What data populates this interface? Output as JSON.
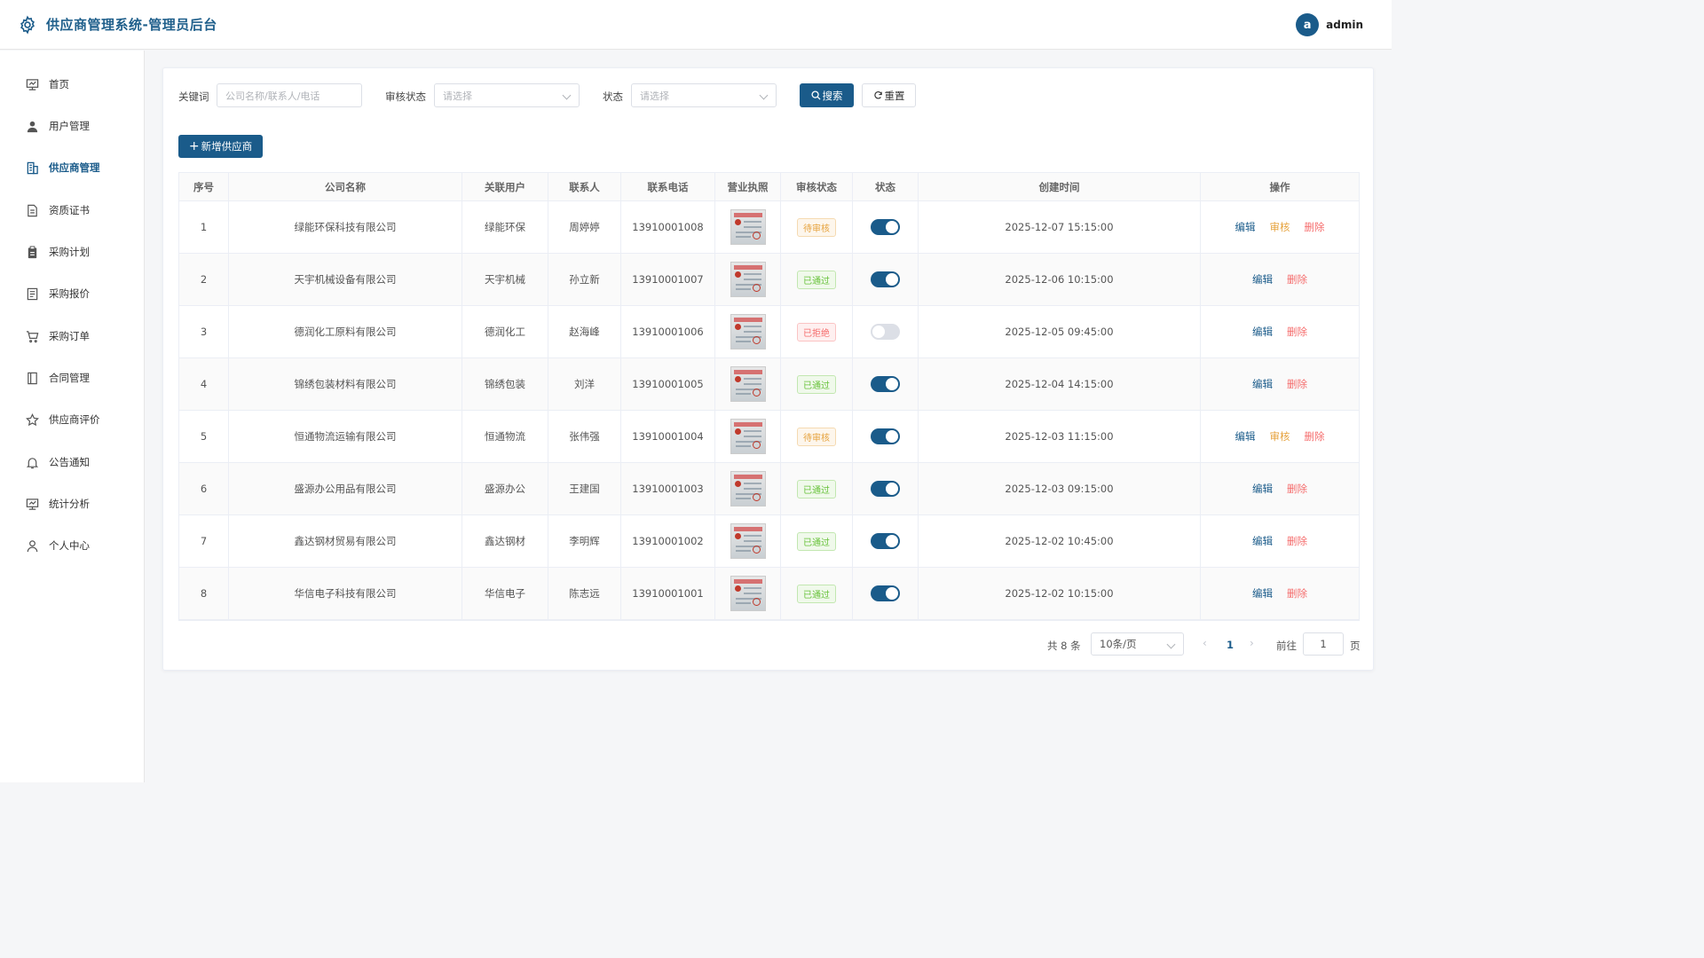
{
  "header": {
    "title": "供应商管理系统-管理员后台",
    "avatar_letter": "a",
    "username": "admin"
  },
  "sidebar": {
    "items": [
      {
        "label": "首页",
        "icon": "dashboard-icon"
      },
      {
        "label": "用户管理",
        "icon": "user-icon"
      },
      {
        "label": "供应商管理",
        "icon": "building-icon",
        "active": true
      },
      {
        "label": "资质证书",
        "icon": "document-icon"
      },
      {
        "label": "采购计划",
        "icon": "clipboard-icon"
      },
      {
        "label": "采购报价",
        "icon": "quote-icon"
      },
      {
        "label": "采购订单",
        "icon": "cart-icon"
      },
      {
        "label": "合同管理",
        "icon": "contract-icon"
      },
      {
        "label": "供应商评价",
        "icon": "star-icon"
      },
      {
        "label": "公告通知",
        "icon": "bell-icon"
      },
      {
        "label": "统计分析",
        "icon": "chart-icon"
      },
      {
        "label": "个人中心",
        "icon": "person-icon"
      }
    ]
  },
  "filters": {
    "keyword_label": "关键词",
    "keyword_placeholder": "公司名称/联系人/电话",
    "audit_label": "审核状态",
    "audit_placeholder": "请选择",
    "status_label": "状态",
    "status_placeholder": "请选择",
    "search_button": "搜索",
    "reset_button": "重置"
  },
  "add_button": "新增供应商",
  "table": {
    "columns": [
      "序号",
      "公司名称",
      "关联用户",
      "联系人",
      "联系电话",
      "营业执照",
      "审核状态",
      "状态",
      "创建时间",
      "操作"
    ],
    "rows": [
      {
        "index": "1",
        "company": "绿能环保科技有限公司",
        "user": "绿能环保",
        "contact": "周婷婷",
        "phone": "13910001008",
        "audit": "待审核",
        "audit_type": "pending",
        "enabled": true,
        "created": "2025-12-07 15:15:00"
      },
      {
        "index": "2",
        "company": "天宇机械设备有限公司",
        "user": "天宇机械",
        "contact": "孙立新",
        "phone": "13910001007",
        "audit": "已通过",
        "audit_type": "approved",
        "enabled": true,
        "created": "2025-12-06 10:15:00"
      },
      {
        "index": "3",
        "company": "德润化工原料有限公司",
        "user": "德润化工",
        "contact": "赵海峰",
        "phone": "13910001006",
        "audit": "已拒绝",
        "audit_type": "rejected",
        "enabled": false,
        "created": "2025-12-05 09:45:00"
      },
      {
        "index": "4",
        "company": "锦绣包装材料有限公司",
        "user": "锦绣包装",
        "contact": "刘洋",
        "phone": "13910001005",
        "audit": "已通过",
        "audit_type": "approved",
        "enabled": true,
        "created": "2025-12-04 14:15:00"
      },
      {
        "index": "5",
        "company": "恒通物流运输有限公司",
        "user": "恒通物流",
        "contact": "张伟强",
        "phone": "13910001004",
        "audit": "待审核",
        "audit_type": "pending",
        "enabled": true,
        "created": "2025-12-03 11:15:00"
      },
      {
        "index": "6",
        "company": "盛源办公用品有限公司",
        "user": "盛源办公",
        "contact": "王建国",
        "phone": "13910001003",
        "audit": "已通过",
        "audit_type": "approved",
        "enabled": true,
        "created": "2025-12-03 09:15:00"
      },
      {
        "index": "7",
        "company": "鑫达钢材贸易有限公司",
        "user": "鑫达钢材",
        "contact": "李明辉",
        "phone": "13910001002",
        "audit": "已通过",
        "audit_type": "approved",
        "enabled": true,
        "created": "2025-12-02 10:45:00"
      },
      {
        "index": "8",
        "company": "华信电子科技有限公司",
        "user": "华信电子",
        "contact": "陈志远",
        "phone": "13910001001",
        "audit": "已通过",
        "audit_type": "approved",
        "enabled": true,
        "created": "2025-12-02 10:15:00"
      }
    ],
    "actions": {
      "edit": "编辑",
      "audit": "审核",
      "delete": "删除"
    }
  },
  "pagination": {
    "total": "共 8 条",
    "page_size": "10条/页",
    "current_page": "1",
    "goto_label": "前往",
    "goto_value": "1",
    "page_suffix": "页"
  },
  "colors": {
    "primary": "#1a5b8a",
    "pending": "#e6a23c",
    "approved": "#67c23a",
    "rejected": "#f56c6c"
  }
}
